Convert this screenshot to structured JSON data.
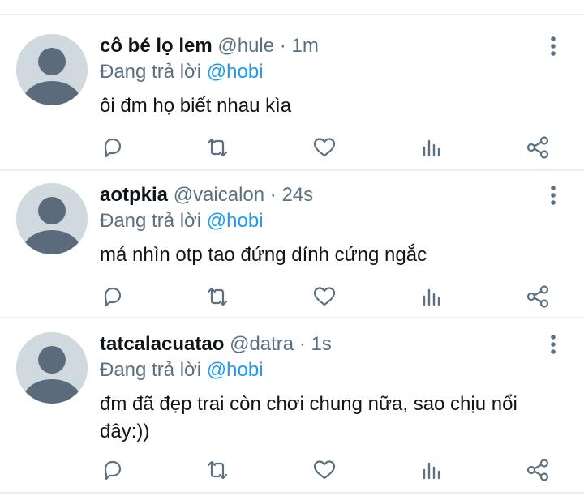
{
  "tweets": [
    {
      "name": "cô bé lọ lem",
      "handle": "@hule",
      "separator": "·",
      "time": "1m",
      "reply_prefix": "Đang trả lời",
      "reply_to": "@hobi",
      "text": "ôi đm họ biết nhau kìa"
    },
    {
      "name": "aotpkia",
      "handle": "@vaicalon",
      "separator": "·",
      "time": "24s",
      "reply_prefix": "Đang trả lời",
      "reply_to": "@hobi",
      "text": "má nhìn otp tao đứng dính cứng ngắc"
    },
    {
      "name": "tatcalacuatao",
      "handle": "@datra",
      "separator": "·",
      "time": "1s",
      "reply_prefix": "Đang trả lời",
      "reply_to": "@hobi",
      "text": "đm đã đẹp trai còn chơi chung nữa, sao chịu nổi đây:))"
    }
  ],
  "icons": {
    "avatar": "default-avatar-icon",
    "more": "more-vertical-icon",
    "reply": "reply-icon",
    "retweet": "retweet-icon",
    "like": "heart-icon",
    "analytics": "analytics-icon",
    "share": "share-icon"
  },
  "colors": {
    "mention": "#1d9bf0",
    "secondary_text": "#5b7083",
    "avatar_bg": "#cfd9de",
    "avatar_fg": "#5b6b7b",
    "divider": "#eceff1"
  }
}
